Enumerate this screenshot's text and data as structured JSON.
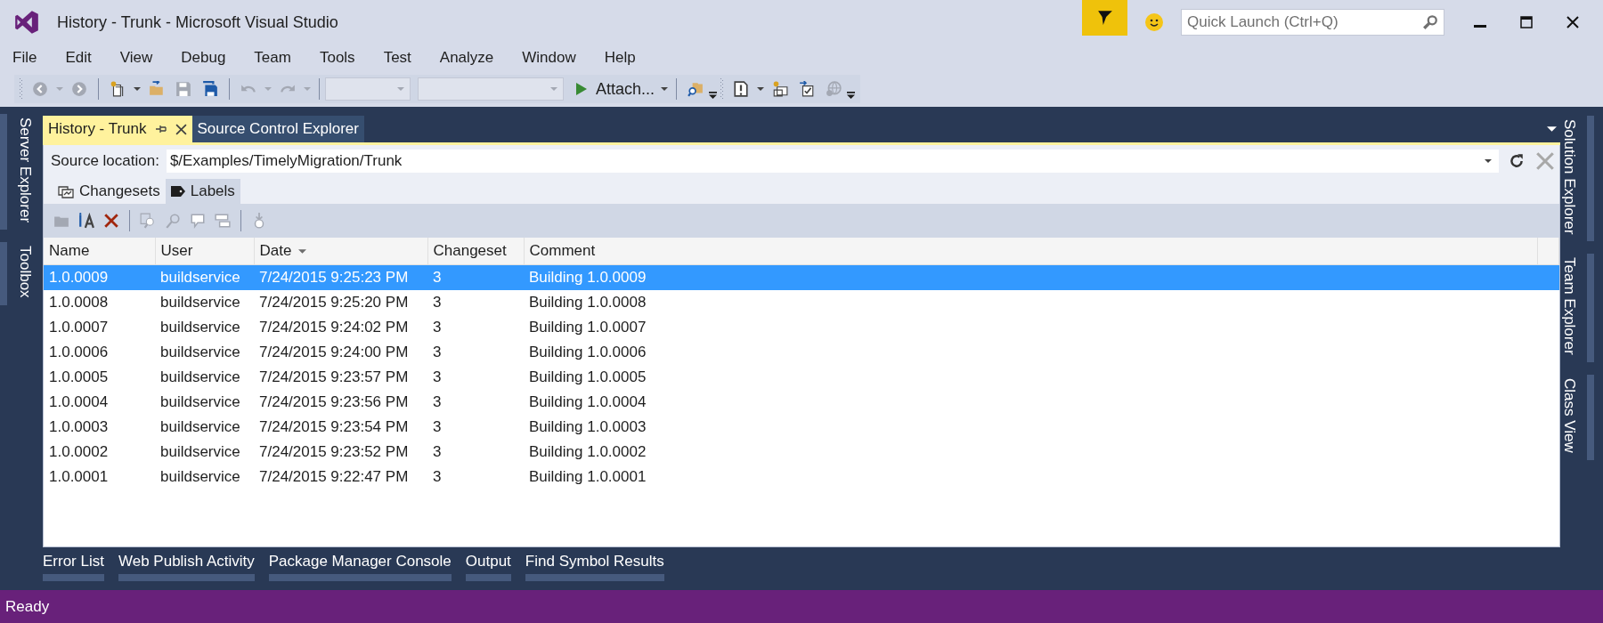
{
  "window": {
    "title": "History - Trunk - Microsoft Visual Studio"
  },
  "quick_launch": {
    "placeholder": "Quick Launch (Ctrl+Q)"
  },
  "menu": [
    "File",
    "Edit",
    "View",
    "Debug",
    "Team",
    "Tools",
    "Test",
    "Analyze",
    "Window",
    "Help"
  ],
  "toolbar": [
    {
      "kind": "button",
      "disabled": true
    },
    {
      "kind": "dropdown",
      "disabled": true
    },
    {
      "kind": "button",
      "disabled": true
    },
    {
      "kind": "separator"
    },
    {
      "kind": "button",
      "disabled": false
    },
    {
      "kind": "dropdown",
      "disabled": false
    },
    {
      "kind": "button",
      "disabled": false
    },
    {
      "kind": "button",
      "disabled": true
    },
    {
      "kind": "button",
      "disabled": false
    },
    {
      "kind": "separator"
    },
    {
      "kind": "button",
      "disabled": true
    },
    {
      "kind": "dropdown",
      "disabled": true
    },
    {
      "kind": "button",
      "disabled": true
    },
    {
      "kind": "dropdown",
      "disabled": true
    },
    {
      "kind": "separator"
    },
    {
      "kind": "combo",
      "disabled": true
    },
    {
      "kind": "combo",
      "disabled": true
    },
    {
      "kind": "command",
      "label": "Attach...",
      "disabled": false
    },
    {
      "kind": "dropdown",
      "disabled": false
    },
    {
      "kind": "separator"
    },
    {
      "kind": "button",
      "disabled": false
    },
    {
      "kind": "overflow"
    },
    {
      "kind": "grip"
    },
    {
      "kind": "button",
      "disabled": false
    },
    {
      "kind": "dropdown",
      "disabled": false
    },
    {
      "kind": "button",
      "disabled": false
    },
    {
      "kind": "button",
      "disabled": false
    },
    {
      "kind": "button",
      "disabled": true
    },
    {
      "kind": "overflow"
    }
  ],
  "left_sidebar": [
    "Server Explorer",
    "Toolbox"
  ],
  "right_sidebar": [
    "Solution Explorer",
    "Team Explorer",
    "Class View"
  ],
  "document_tabs": [
    {
      "label": "History - Trunk",
      "selected": true
    },
    {
      "label": "Source Control Explorer",
      "selected": false
    }
  ],
  "history": {
    "source_location": {
      "label": "Source location:",
      "value": "$/Examples/TimelyMigration/Trunk"
    },
    "view_tabs": [
      {
        "label": "Changesets",
        "selected": false
      },
      {
        "label": "Labels",
        "selected": true
      }
    ],
    "toolbar": [
      {
        "kind": "button",
        "disabled": true
      },
      {
        "kind": "button",
        "disabled": false
      },
      {
        "kind": "button",
        "disabled": false
      },
      {
        "kind": "separator"
      },
      {
        "kind": "button",
        "disabled": true
      },
      {
        "kind": "button",
        "disabled": true
      },
      {
        "kind": "button",
        "disabled": true
      },
      {
        "kind": "button",
        "disabled": true
      },
      {
        "kind": "separator"
      },
      {
        "kind": "button",
        "disabled": true
      }
    ],
    "columns": [
      {
        "label": "Name",
        "sorted": false
      },
      {
        "label": "User",
        "sorted": false
      },
      {
        "label": "Date",
        "sorted": true
      },
      {
        "label": "Changeset",
        "sorted": false
      },
      {
        "label": "Comment",
        "sorted": false
      }
    ],
    "rows": [
      {
        "selected": true,
        "cells": [
          "1.0.0009",
          "buildservice",
          "7/24/2015 9:25:23 PM",
          "3",
          "Building 1.0.0009"
        ]
      },
      {
        "selected": false,
        "cells": [
          "1.0.0008",
          "buildservice",
          "7/24/2015 9:25:20 PM",
          "3",
          "Building 1.0.0008"
        ]
      },
      {
        "selected": false,
        "cells": [
          "1.0.0007",
          "buildservice",
          "7/24/2015 9:24:02 PM",
          "3",
          "Building 1.0.0007"
        ]
      },
      {
        "selected": false,
        "cells": [
          "1.0.0006",
          "buildservice",
          "7/24/2015 9:24:00 PM",
          "3",
          "Building 1.0.0006"
        ]
      },
      {
        "selected": false,
        "cells": [
          "1.0.0005",
          "buildservice",
          "7/24/2015 9:23:57 PM",
          "3",
          "Building 1.0.0005"
        ]
      },
      {
        "selected": false,
        "cells": [
          "1.0.0004",
          "buildservice",
          "7/24/2015 9:23:56 PM",
          "3",
          "Building 1.0.0004"
        ]
      },
      {
        "selected": false,
        "cells": [
          "1.0.0003",
          "buildservice",
          "7/24/2015 9:23:54 PM",
          "3",
          "Building 1.0.0003"
        ]
      },
      {
        "selected": false,
        "cells": [
          "1.0.0002",
          "buildservice",
          "7/24/2015 9:23:52 PM",
          "3",
          "Building 1.0.0002"
        ]
      },
      {
        "selected": false,
        "cells": [
          "1.0.0001",
          "buildservice",
          "7/24/2015 9:22:47 PM",
          "3",
          "Building 1.0.0001"
        ]
      }
    ]
  },
  "bottom_tabs": [
    "Error List",
    "Web Publish Activity",
    "Package Manager Console",
    "Output",
    "Find Symbol Results"
  ],
  "status_bar": {
    "text": "Ready"
  }
}
